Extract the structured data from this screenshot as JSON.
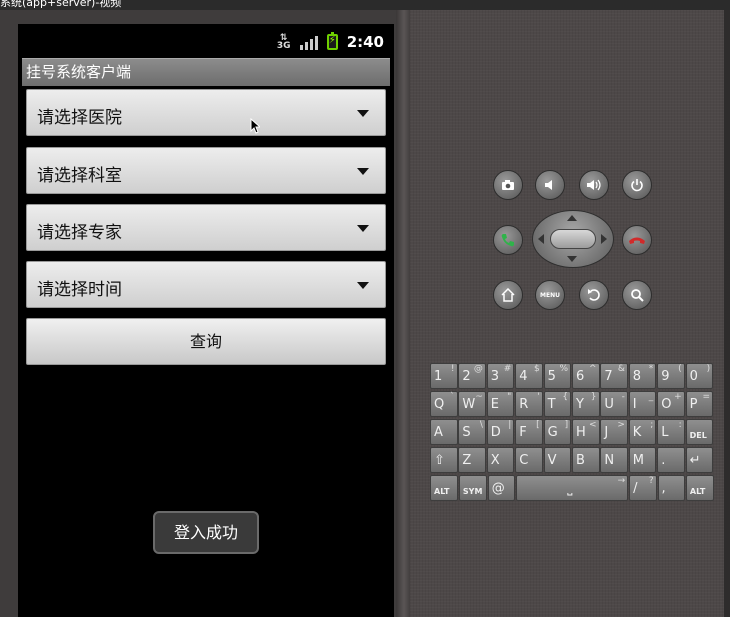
{
  "window": {
    "title": "系统(app+server)-视频"
  },
  "status_bar": {
    "network": "3G",
    "time": "2:40"
  },
  "app": {
    "title": "挂号系统客户端",
    "spinners": [
      {
        "label": "请选择医院"
      },
      {
        "label": "请选择科室"
      },
      {
        "label": "请选择专家"
      },
      {
        "label": "请选择时间"
      }
    ],
    "query_label": "查询",
    "toast": "登入成功"
  },
  "hardware": {
    "menu_label": "MENU",
    "buttons": [
      "camera-icon",
      "volume-down-icon",
      "volume-up-icon",
      "power-icon",
      "call-icon",
      "end-call-icon",
      "home-icon",
      "back-icon",
      "search-icon"
    ]
  },
  "keyboard": {
    "rows": [
      [
        {
          "k": "1",
          "a": "!"
        },
        {
          "k": "2",
          "a": "@"
        },
        {
          "k": "3",
          "a": "#"
        },
        {
          "k": "4",
          "a": "$"
        },
        {
          "k": "5",
          "a": "%"
        },
        {
          "k": "6",
          "a": "^"
        },
        {
          "k": "7",
          "a": "&"
        },
        {
          "k": "8",
          "a": "*"
        },
        {
          "k": "9",
          "a": "("
        },
        {
          "k": "0",
          "a": ")"
        }
      ],
      [
        {
          "k": "Q",
          "a": "`"
        },
        {
          "k": "W",
          "a": "~"
        },
        {
          "k": "E",
          "a": "\""
        },
        {
          "k": "R",
          "a": "'"
        },
        {
          "k": "T",
          "a": "{"
        },
        {
          "k": "Y",
          "a": "}"
        },
        {
          "k": "U",
          "a": "-"
        },
        {
          "k": "I",
          "a": "_"
        },
        {
          "k": "O",
          "a": "+"
        },
        {
          "k": "P",
          "a": "="
        }
      ],
      [
        {
          "k": "A",
          "a": ""
        },
        {
          "k": "S",
          "a": "\\"
        },
        {
          "k": "D",
          "a": "|"
        },
        {
          "k": "F",
          "a": "["
        },
        {
          "k": "G",
          "a": "]"
        },
        {
          "k": "H",
          "a": "<"
        },
        {
          "k": "J",
          "a": ">"
        },
        {
          "k": "K",
          "a": ";"
        },
        {
          "k": "L",
          "a": ":"
        },
        {
          "k": "DEL",
          "a": ""
        }
      ],
      [
        {
          "k": "⇧",
          "a": ""
        },
        {
          "k": "Z",
          "a": ""
        },
        {
          "k": "X",
          "a": ""
        },
        {
          "k": "C",
          "a": ""
        },
        {
          "k": "V",
          "a": ""
        },
        {
          "k": "B",
          "a": ""
        },
        {
          "k": "N",
          "a": ""
        },
        {
          "k": "M",
          "a": ""
        },
        {
          "k": ".",
          "a": ""
        },
        {
          "k": "↵",
          "a": ""
        }
      ],
      [
        {
          "k": "ALT",
          "a": ""
        },
        {
          "k": "SYM",
          "a": ""
        },
        {
          "k": "@",
          "a": ""
        },
        {
          "k": "␣",
          "a": "→"
        },
        {
          "k": "/",
          "a": "?"
        },
        {
          "k": ",",
          "a": ""
        },
        {
          "k": "ALT",
          "a": ""
        }
      ]
    ]
  },
  "colors": {
    "screen": "#000000",
    "panel": "#4d4848",
    "battery": "#6fd000",
    "call": "#2fb34a",
    "end_call": "#d12a2a"
  }
}
